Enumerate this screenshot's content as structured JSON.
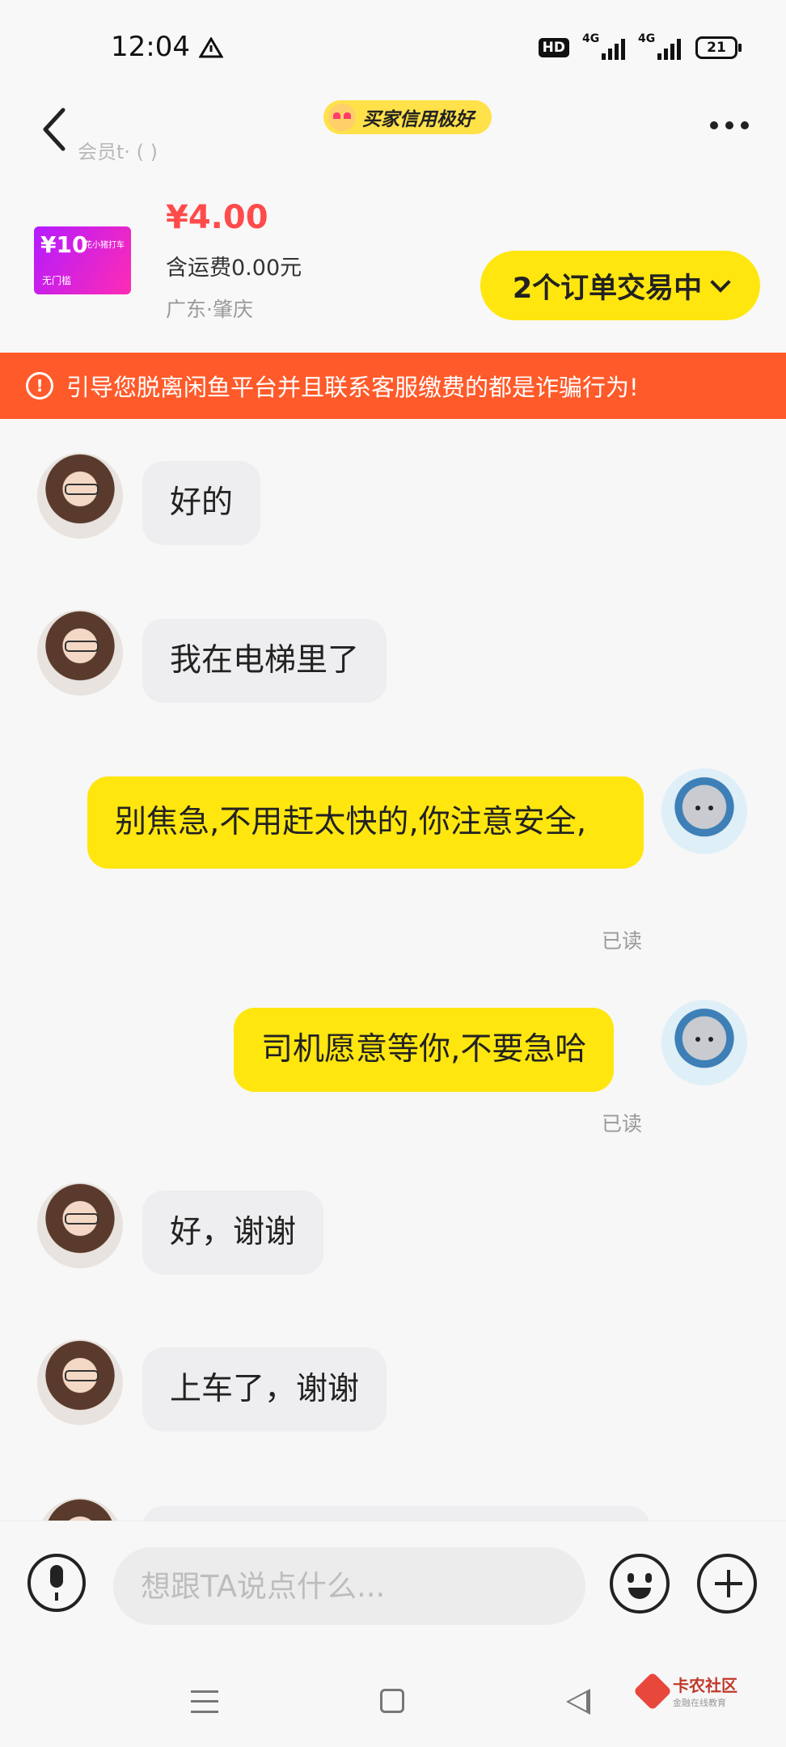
{
  "status_bar": {
    "time": "12:04",
    "hd_label": "HD",
    "signal_1": "4G",
    "signal_2": "4G",
    "battery": "21"
  },
  "header": {
    "seller_sub": "会员t· ( )",
    "credit_badge": "买家信用极好"
  },
  "product": {
    "thumb_value": "¥10",
    "thumb_brand": "花小猪打车",
    "thumb_tag": "无门槛",
    "price": "¥4.00",
    "shipping": "含运费0.00元",
    "location": "广东·肇庆",
    "orders_button": "2个订单交易中"
  },
  "warning": {
    "text": "引导您脱离闲鱼平台并且联系客服缴费的都是诈骗行为!"
  },
  "messages": [
    {
      "side": "in",
      "text": "好的"
    },
    {
      "side": "in",
      "text": "我在电梯里了"
    },
    {
      "side": "out",
      "text": "别焦急,不用赶太快的,你注意安全,",
      "status": "已读"
    },
    {
      "side": "out",
      "text": "司机愿意等你,不要急哈",
      "status": "已读"
    },
    {
      "side": "in",
      "text": "好，谢谢"
    },
    {
      "side": "in",
      "text": "上车了，谢谢"
    }
  ],
  "input": {
    "placeholder": "想跟TA说点什么..."
  },
  "watermark": {
    "title": "卡农社区",
    "subtitle": "金融在线教育"
  },
  "colors": {
    "accent_yellow": "#ffe60f",
    "price_red": "#ff4b4b",
    "warning_orange": "#ff5a2a"
  }
}
